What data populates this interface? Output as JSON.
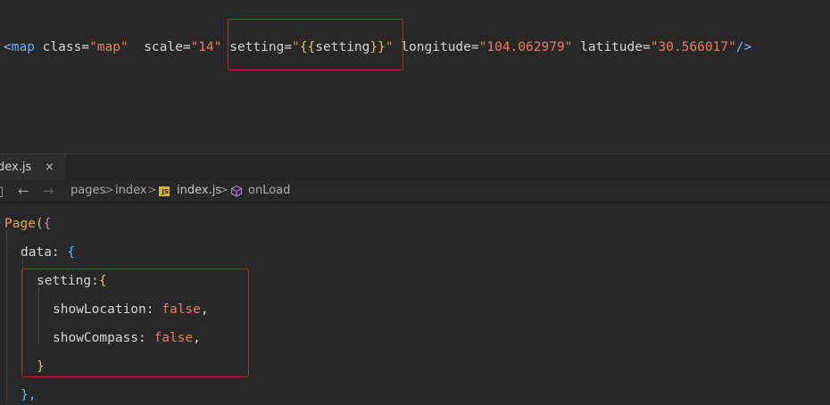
{
  "wxml": {
    "open": "<",
    "tag": "map",
    "attr_class": "class=",
    "class_value": "\"map\"",
    "attr_scale": "scale=",
    "scale_value": "\"14\"",
    "attr_setting": "setting=",
    "setting_quote_open": "\"",
    "setting_brace_open": "{{",
    "setting_var": "setting",
    "setting_brace_close": "}}",
    "setting_quote_close": "\"",
    "attr_longitude": "longitude=",
    "longitude_value": "\"104.062979\"",
    "attr_latitude": "latitude=",
    "latitude_value": "\"30.566017\"",
    "close": "/>"
  },
  "tab": {
    "label": "dex.js",
    "close_glyph": "×"
  },
  "breadcrumb": {
    "back_icon": "arrow-left-icon",
    "forward_icon": "arrow-right-icon",
    "items": [
      "pages",
      "index",
      "index.js",
      "onLoad"
    ],
    "separator": ">",
    "file_badge": "JS"
  },
  "code": {
    "line1_fn": "Page",
    "line1_paren": "(",
    "line1_brace": "{",
    "line2_key": "data:",
    "line2_brace": "{",
    "line3_key": "setting:",
    "line3_brace": "{",
    "line4_key": "showLocation:",
    "line4_value": "false",
    "line4_comma": ",",
    "line5_key": "showCompass:",
    "line5_value": "false",
    "line5_comma": ",",
    "line6_brace": "}",
    "line7_text": "},"
  },
  "colors": {
    "background": "#282828",
    "highlight_box": "#b02b2b",
    "string": "#f07a5c",
    "tag": "#62b0ff",
    "function": "#e0a24a"
  }
}
